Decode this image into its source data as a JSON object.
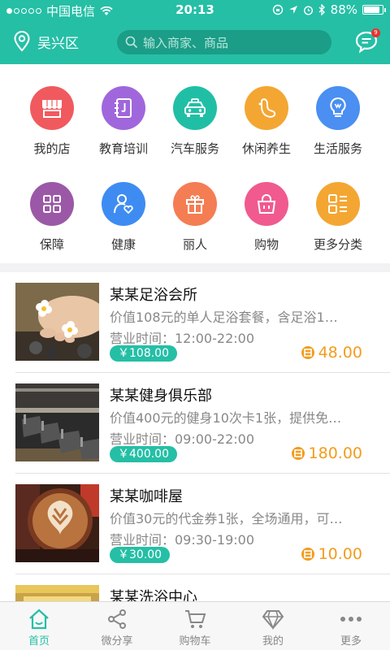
{
  "status_bar": {
    "carrier": "中国电信",
    "time": "20:13",
    "battery": "88%",
    "battery_level": 0.88
  },
  "header": {
    "location": "吴兴区",
    "search_placeholder": "输入商家、商品",
    "message_badge": "9"
  },
  "categories": [
    {
      "label": "我的店",
      "icon": "shop-icon",
      "color": "#f05a5e"
    },
    {
      "label": "教育培训",
      "icon": "book-icon",
      "color": "#a067dc"
    },
    {
      "label": "汽车服务",
      "icon": "car-icon",
      "color": "#20bfa5"
    },
    {
      "label": "休闲养生",
      "icon": "foot-icon",
      "color": "#f4a632"
    },
    {
      "label": "生活服务",
      "icon": "bulb-icon",
      "color": "#4a8ff1"
    },
    {
      "label": "保障",
      "icon": "grid-icon",
      "color": "#9b58a6"
    },
    {
      "label": "健康",
      "icon": "health-icon",
      "color": "#3e8cf2"
    },
    {
      "label": "丽人",
      "icon": "gift-icon",
      "color": "#f57d53"
    },
    {
      "label": "购物",
      "icon": "bag-icon",
      "color": "#f05a8f"
    },
    {
      "label": "更多分类",
      "icon": "more-list-icon",
      "color": "#f4a632"
    }
  ],
  "merchants": [
    {
      "name": "某某足浴会所",
      "desc": "价值108元的单人足浴套餐，含足浴1…",
      "hours": "营业时间：12:00-22:00",
      "price": "￥108.00",
      "points": "48.00",
      "image": "foot-spa"
    },
    {
      "name": "某某健身俱乐部",
      "desc": "价值400元的健身10次卡1张，提供免…",
      "hours": "营业时间：09:00-22:00",
      "price": "￥400.00",
      "points": "180.00",
      "image": "gym"
    },
    {
      "name": "某某咖啡屋",
      "desc": "价值30元的代金券1张，全场通用，可…",
      "hours": "营业时间：09:30-19:00",
      "price": "￥30.00",
      "points": "10.00",
      "image": "coffee"
    },
    {
      "name": "某某洗浴中心",
      "desc": "",
      "hours": "",
      "price": "",
      "points": "",
      "image": "bath"
    }
  ],
  "tabs": [
    {
      "label": "首页",
      "icon": "home-icon",
      "active": true
    },
    {
      "label": "微分享",
      "icon": "share-icon",
      "active": false
    },
    {
      "label": "购物车",
      "icon": "cart-icon",
      "active": false
    },
    {
      "label": "我的",
      "icon": "diamond-icon",
      "active": false
    },
    {
      "label": "更多",
      "icon": "more-dots-icon",
      "active": false
    }
  ],
  "colors": {
    "brand": "#25bfa6",
    "points": "#f39c1d",
    "badge": "#e8312f"
  }
}
